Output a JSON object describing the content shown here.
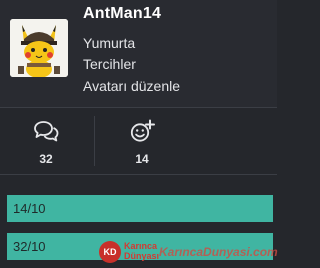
{
  "profile": {
    "username": "AntMan14",
    "rank": "Yumurta",
    "preferences_label": "Tercihler",
    "edit_avatar_label": "Avatarı düzenle"
  },
  "stats": {
    "messages": {
      "icon": "messages-icon",
      "count": "32"
    },
    "reactions": {
      "icon": "reaction-add-icon",
      "count": "14"
    }
  },
  "progress": [
    {
      "label": "14/10",
      "fill": 1.0
    },
    {
      "label": "32/10",
      "fill": 1.0
    }
  ],
  "watermark": {
    "logo_text": "KD",
    "brand_line1": "Karınca",
    "brand_line2": "Dünyası",
    "domain": "KarıncaDunyasi.com"
  },
  "colors": {
    "background": "#25272c",
    "progress_fill": "#40b5a2",
    "text": "#e6e7ea"
  }
}
